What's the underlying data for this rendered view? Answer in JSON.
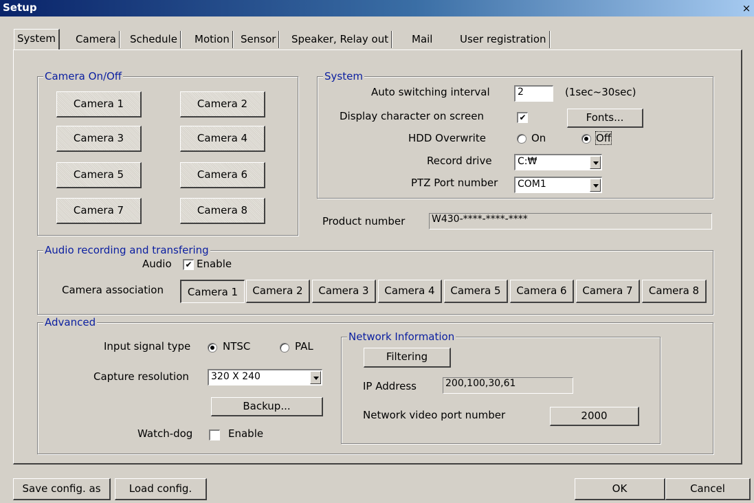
{
  "window": {
    "title": "Setup",
    "close": "×"
  },
  "tabs": [
    "System",
    "Camera",
    "Schedule",
    "Motion",
    "Sensor",
    "Speaker, Relay out",
    "Mail",
    "User registration"
  ],
  "camera_onoff": {
    "title": "Camera On/Off",
    "buttons": [
      "Camera 1",
      "Camera 2",
      "Camera 3",
      "Camera 4",
      "Camera 5",
      "Camera 6",
      "Camera 7",
      "Camera 8"
    ]
  },
  "system": {
    "title": "System",
    "auto_switching_label": "Auto switching interval",
    "auto_switching_value": "2",
    "auto_switching_range": "(1sec~30sec)",
    "display_char_label": "Display character on screen",
    "display_char_checked": "✔",
    "fonts_button": "Fonts...",
    "hdd_label": "HDD Overwrite",
    "hdd_on": "On",
    "hdd_off": "Off",
    "record_drive_label": "Record drive",
    "record_drive_value": "C:₩",
    "ptz_label": "PTZ Port number",
    "ptz_value": "COM1"
  },
  "product": {
    "label": "Product number",
    "value": "W430-****-****-****"
  },
  "audio": {
    "title": "Audio recording and transfering",
    "audio_label": "Audio",
    "enable_label": "Enable",
    "enable_checked": "✔",
    "association_label": "Camera association",
    "cameras": [
      "Camera 1",
      "Camera 2",
      "Camera 3",
      "Camera 4",
      "Camera 5",
      "Camera 6",
      "Camera 7",
      "Camera 8"
    ]
  },
  "advanced": {
    "title": "Advanced",
    "input_signal_label": "Input signal type",
    "ntsc": "NTSC",
    "pal": "PAL",
    "capture_label": "Capture resolution",
    "capture_value": "320 X 240",
    "backup_button": "Backup...",
    "watchdog_label": "Watch-dog",
    "watchdog_enable": "Enable"
  },
  "network": {
    "title": "Network Information",
    "filtering_button": "Filtering",
    "ip_label": "IP Address",
    "ip_value": "200,100,30,61",
    "port_label": "Network video port number",
    "port_value": "2000"
  },
  "footer": {
    "save_as": "Save config. as",
    "load": "Load config.",
    "ok": "OK",
    "cancel": "Cancel"
  }
}
